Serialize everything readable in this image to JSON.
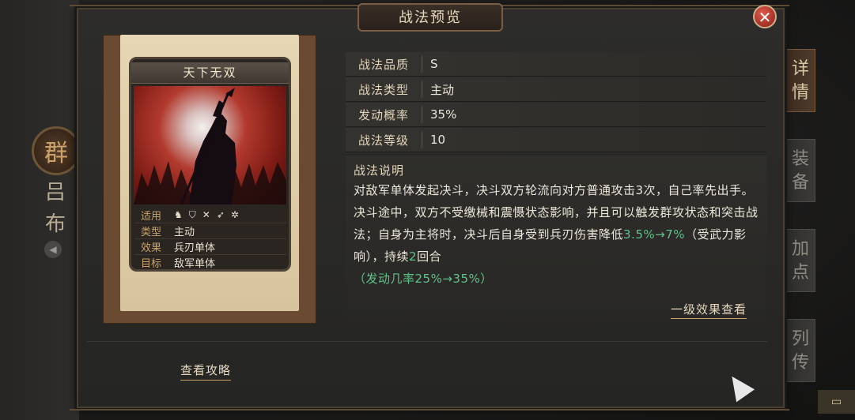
{
  "title": "战法预览",
  "close_label": "✕",
  "faction": "群",
  "hero_name": "吕布",
  "side_tabs": [
    {
      "label": "详情",
      "active": true
    },
    {
      "label": "装备",
      "active": false
    },
    {
      "label": "加点",
      "active": false
    },
    {
      "label": "列传",
      "active": false
    }
  ],
  "card": {
    "title": "天下无双",
    "rows": [
      {
        "k": "适用",
        "v": ""
      },
      {
        "k": "类型",
        "v": "主动"
      },
      {
        "k": "效果",
        "v": "兵刃单体"
      },
      {
        "k": "目标",
        "v": "敌军单体"
      }
    ],
    "unit_icons": [
      "cavalry-icon",
      "shield-icon",
      "bow-icon",
      "spear-icon",
      "wheel-icon"
    ]
  },
  "info": [
    {
      "k": "战法品质",
      "v": "S"
    },
    {
      "k": "战法类型",
      "v": "主动"
    },
    {
      "k": "发动概率",
      "v": "35%"
    },
    {
      "k": "战法等级",
      "v": "10"
    }
  ],
  "description": {
    "title": "战法说明",
    "text_1": "对敌军单体发起决斗，决斗双方轮流向对方普通攻击3次，自己率先出手。决斗途中，双方不受缴械和震慑状态影响，并且可以触发群攻状态和突击战法；自身为主将时，决斗后自身受到兵刃伤害降低",
    "green_1": "3.5%→7%",
    "text_2": "（受武力影响），持续",
    "green_2": "2",
    "text_3": "回合",
    "green_3": "（发动几率25%→35%）"
  },
  "effect_link": "一级效果查看",
  "guide_link": "查看攻略",
  "colors": {
    "accent": "#c9a36a",
    "green": "#5fc28a",
    "close": "#b3352a"
  }
}
